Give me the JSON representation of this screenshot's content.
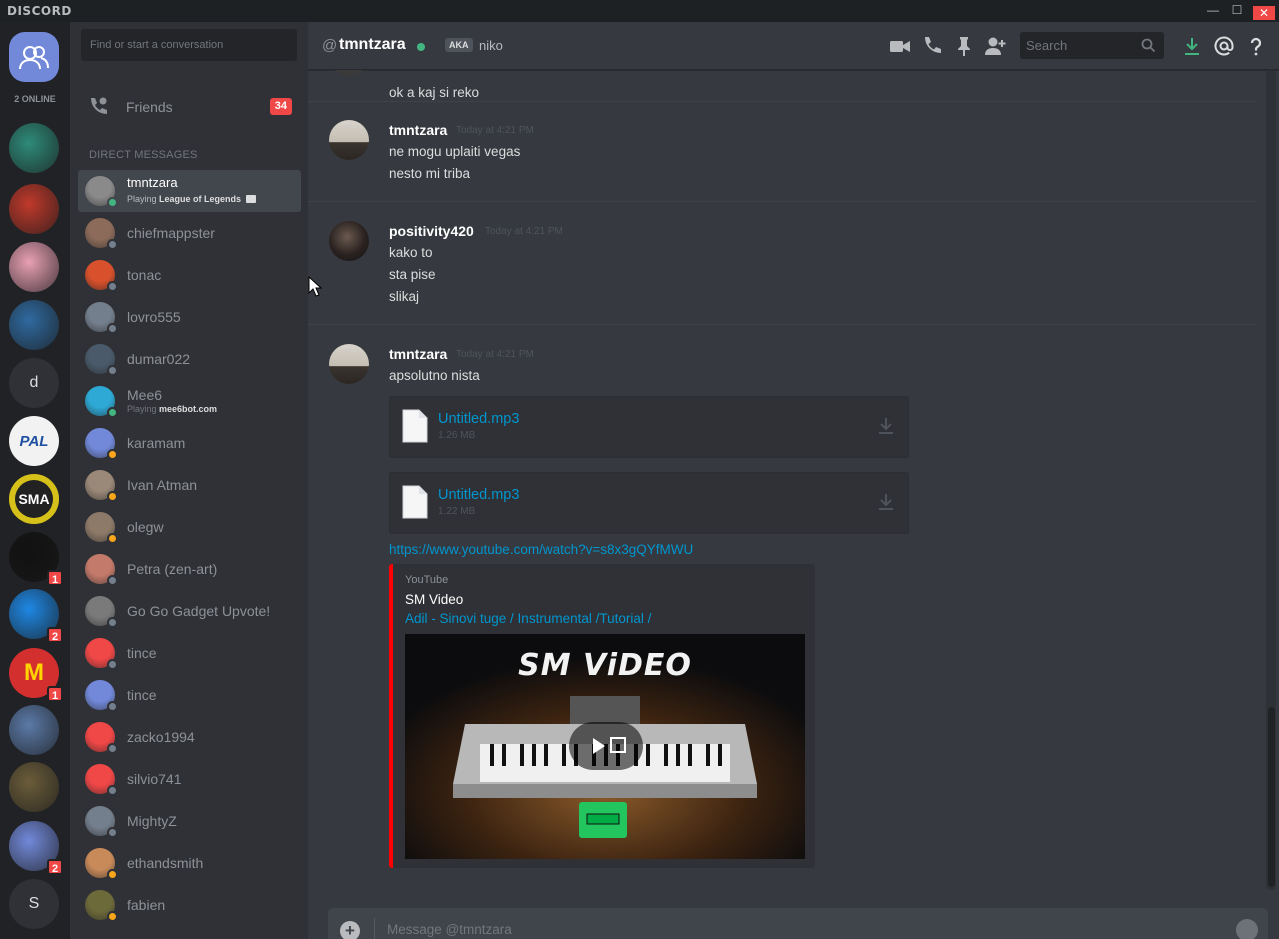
{
  "app": {
    "logo": "DISCORD",
    "minimize": "—",
    "maximize": "☐",
    "close": "✕"
  },
  "guilds": {
    "online": "2 ONLINE",
    "items": [
      {
        "kind": "image",
        "color": "#2e8b7a",
        "badge": ""
      },
      {
        "kind": "image",
        "color": "#c0392b",
        "badge": ""
      },
      {
        "kind": "image",
        "color": "#e8a0b4",
        "badge": ""
      },
      {
        "kind": "image",
        "color": "#2f6aa0",
        "badge": ""
      },
      {
        "kind": "letter",
        "label": "d",
        "color": "#2f3136",
        "badge": ""
      },
      {
        "kind": "letter",
        "label": "PAL",
        "color": "#f2f2f2",
        "badge": ""
      },
      {
        "kind": "letter",
        "label": "SMA",
        "color": "#d6c11b",
        "badge": ""
      },
      {
        "kind": "image",
        "color": "#111111",
        "badge": "1"
      },
      {
        "kind": "image",
        "color": "#1e88e5",
        "badge": "2"
      },
      {
        "kind": "letter",
        "label": "M",
        "color": "#d32f2f",
        "badge": "1"
      },
      {
        "kind": "image",
        "color": "#5b7aa8",
        "badge": ""
      },
      {
        "kind": "image",
        "color": "#6b5d3a",
        "badge": ""
      },
      {
        "kind": "image",
        "color": "#7289da",
        "badge": "2"
      },
      {
        "kind": "letter",
        "label": "S",
        "color": "#2f3136",
        "badge": ""
      }
    ]
  },
  "sidebar": {
    "search_placeholder": "Find or start a conversation",
    "friends": {
      "label": "Friends",
      "count": "34"
    },
    "dm_header": "DIRECT MESSAGES",
    "dms": [
      {
        "name": "tmntzara",
        "status": "online",
        "active": true,
        "sub_prefix": "Playing ",
        "sub_game": "League of Legends",
        "avatar": "#8a8a8a"
      },
      {
        "name": "chiefmappster",
        "status": "offline",
        "active": false,
        "avatar": "#8c6b5a"
      },
      {
        "name": "tonac",
        "status": "offline",
        "active": false,
        "avatar": "#d9512c"
      },
      {
        "name": "lovro555",
        "status": "offline",
        "active": false,
        "avatar": "#747f8d"
      },
      {
        "name": "dumar022",
        "status": "offline",
        "active": false,
        "avatar": "#4a5a6a"
      },
      {
        "name": "Mee6",
        "status": "online",
        "active": false,
        "sub_prefix": "Playing ",
        "sub_game": "mee6bot.com",
        "avatar": "#2ea8d4"
      },
      {
        "name": "karamam",
        "status": "idle",
        "active": false,
        "avatar": "#7289da"
      },
      {
        "name": "Ivan Atman",
        "status": "idle",
        "active": false,
        "avatar": "#9a8878"
      },
      {
        "name": "olegw",
        "status": "idle",
        "active": false,
        "avatar": "#8d7a68"
      },
      {
        "name": "Petra (zen-art)",
        "status": "offline",
        "active": false,
        "avatar": "#c47a6a"
      },
      {
        "name": "Go Go Gadget Upvote!",
        "status": "offline",
        "active": false,
        "avatar": "#7a7a7a"
      },
      {
        "name": "tince",
        "status": "offline",
        "active": false,
        "avatar": "#f04747"
      },
      {
        "name": "tince",
        "status": "offline",
        "active": false,
        "avatar": "#7289da"
      },
      {
        "name": "zacko1994",
        "status": "offline",
        "active": false,
        "avatar": "#f04747"
      },
      {
        "name": "silvio741",
        "status": "offline",
        "active": false,
        "avatar": "#f04747"
      },
      {
        "name": "MightyZ",
        "status": "offline",
        "active": false,
        "avatar": "#747f8d"
      },
      {
        "name": "ethandsmith",
        "status": "idle",
        "active": false,
        "avatar": "#c98a5a"
      },
      {
        "name": "fabien",
        "status": "idle",
        "active": false,
        "avatar": "#6d6a3a"
      }
    ]
  },
  "header": {
    "at": "@",
    "name": "tmntzara",
    "aka": "AKA",
    "aka_name": "niko",
    "search_placeholder": "Search"
  },
  "messages": {
    "top_line": "ok a kaj si reko",
    "groups": [
      {
        "author": "tmntzara",
        "time": "Today at 4:21 PM",
        "lines": [
          "ne mogu uplaiti vegas",
          "nesto mi triba"
        ]
      },
      {
        "author": "positivity420",
        "time": "Today at 4:21 PM",
        "lines": [
          "kako to",
          "sta pise",
          "slikaj"
        ]
      },
      {
        "author": "tmntzara",
        "time": "Today at 4:21 PM",
        "lines": [
          "apsolutno nista"
        ]
      }
    ],
    "attachments": [
      {
        "name": "Untitled.mp3",
        "size": "1.26 MB"
      },
      {
        "name": "Untitled.mp3",
        "size": "1.22 MB"
      }
    ],
    "link": "https://www.youtube.com/watch?v=s8x3gQYfMWU",
    "embed": {
      "provider": "YouTube",
      "title": "SM Video",
      "description": "Adil - Sinovi tuge / Instrumental /Tutorial /",
      "thumb_text": "SM ViDEO"
    }
  },
  "composer": {
    "placeholder": "Message @tmntzara"
  },
  "colors": {
    "accent": "#7289da",
    "online": "#43b581",
    "idle": "#faa61a",
    "offline": "#747f8d",
    "link": "#0096cf",
    "danger": "#f04747"
  }
}
